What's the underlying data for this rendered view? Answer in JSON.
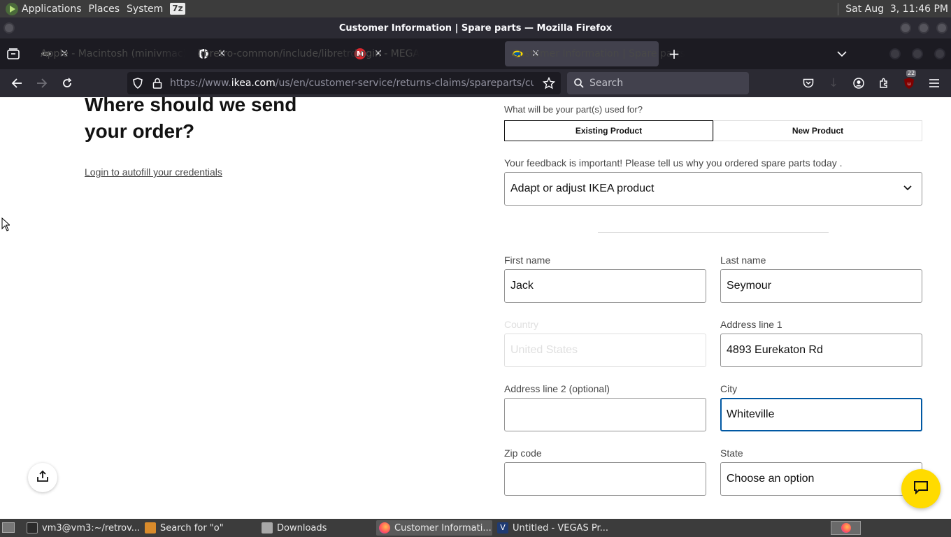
{
  "panel": {
    "menus": [
      "Applications",
      "Places",
      "System"
    ],
    "sevenz": "7z",
    "clock": "Sat Aug  3, 11:46 PM"
  },
  "window": {
    "title": "Customer Information | Spare parts — Mozilla Firefox"
  },
  "tabs": [
    {
      "label": "Apple - Macintosh (minivmac)",
      "favicon": "apple-icon"
    },
    {
      "label": "libretro-common/include/libretro.h",
      "favicon": "github-icon"
    },
    {
      "label": "Login - MEGA",
      "favicon": "mega-icon"
    },
    {
      "label": "Customer Information | Spare parts",
      "favicon": "ikea-icon"
    }
  ],
  "navbar": {
    "url_prefix": "https://www.",
    "url_host": "ikea.com",
    "url_rest": "/us/en/customer-service/returns-claims/spareparts/customer-information",
    "search_placeholder": "Search",
    "ublock_badge": "22"
  },
  "page": {
    "heading": "Where should we send your order?",
    "login_link": "Login to autofill your credentials",
    "parts_question": "What will be your part(s) used for?",
    "segments": {
      "existing": "Existing Product",
      "new": "New Product",
      "selected": "existing"
    },
    "feedback_label": "Your feedback is important! Please tell us why you ordered spare parts today .",
    "feedback_value": "Adapt or adjust IKEA product",
    "form": {
      "first_name": {
        "label": "First name",
        "value": "Jack"
      },
      "last_name": {
        "label": "Last name",
        "value": "Seymour"
      },
      "country": {
        "label": "Country",
        "value": "United States"
      },
      "address1": {
        "label": "Address line 1",
        "value": "4893 Eurekaton Rd"
      },
      "address2": {
        "label": "Address line 2 (optional)",
        "value": ""
      },
      "city": {
        "label": "City",
        "value": "Whiteville"
      },
      "zip": {
        "label": "Zip code",
        "value": ""
      },
      "state": {
        "label": "State",
        "value": "Choose an option"
      }
    }
  },
  "taskbar": [
    {
      "label": "vm3@vm3:~/retrov...",
      "icon": "terminal-icon"
    },
    {
      "label": "Search for \"o\"",
      "icon": "search-folder-icon"
    },
    {
      "label": "Downloads",
      "icon": "folder-icon"
    },
    {
      "label": "Customer Informati...",
      "icon": "firefox-icon",
      "active": true
    },
    {
      "label": "Untitled - VEGAS Pr...",
      "icon": "vegas-icon"
    }
  ],
  "colors": {
    "ikea_blue": "#0058a3",
    "chat_yellow": "#ffdb00",
    "firefox_dark": "#2b2a33"
  }
}
